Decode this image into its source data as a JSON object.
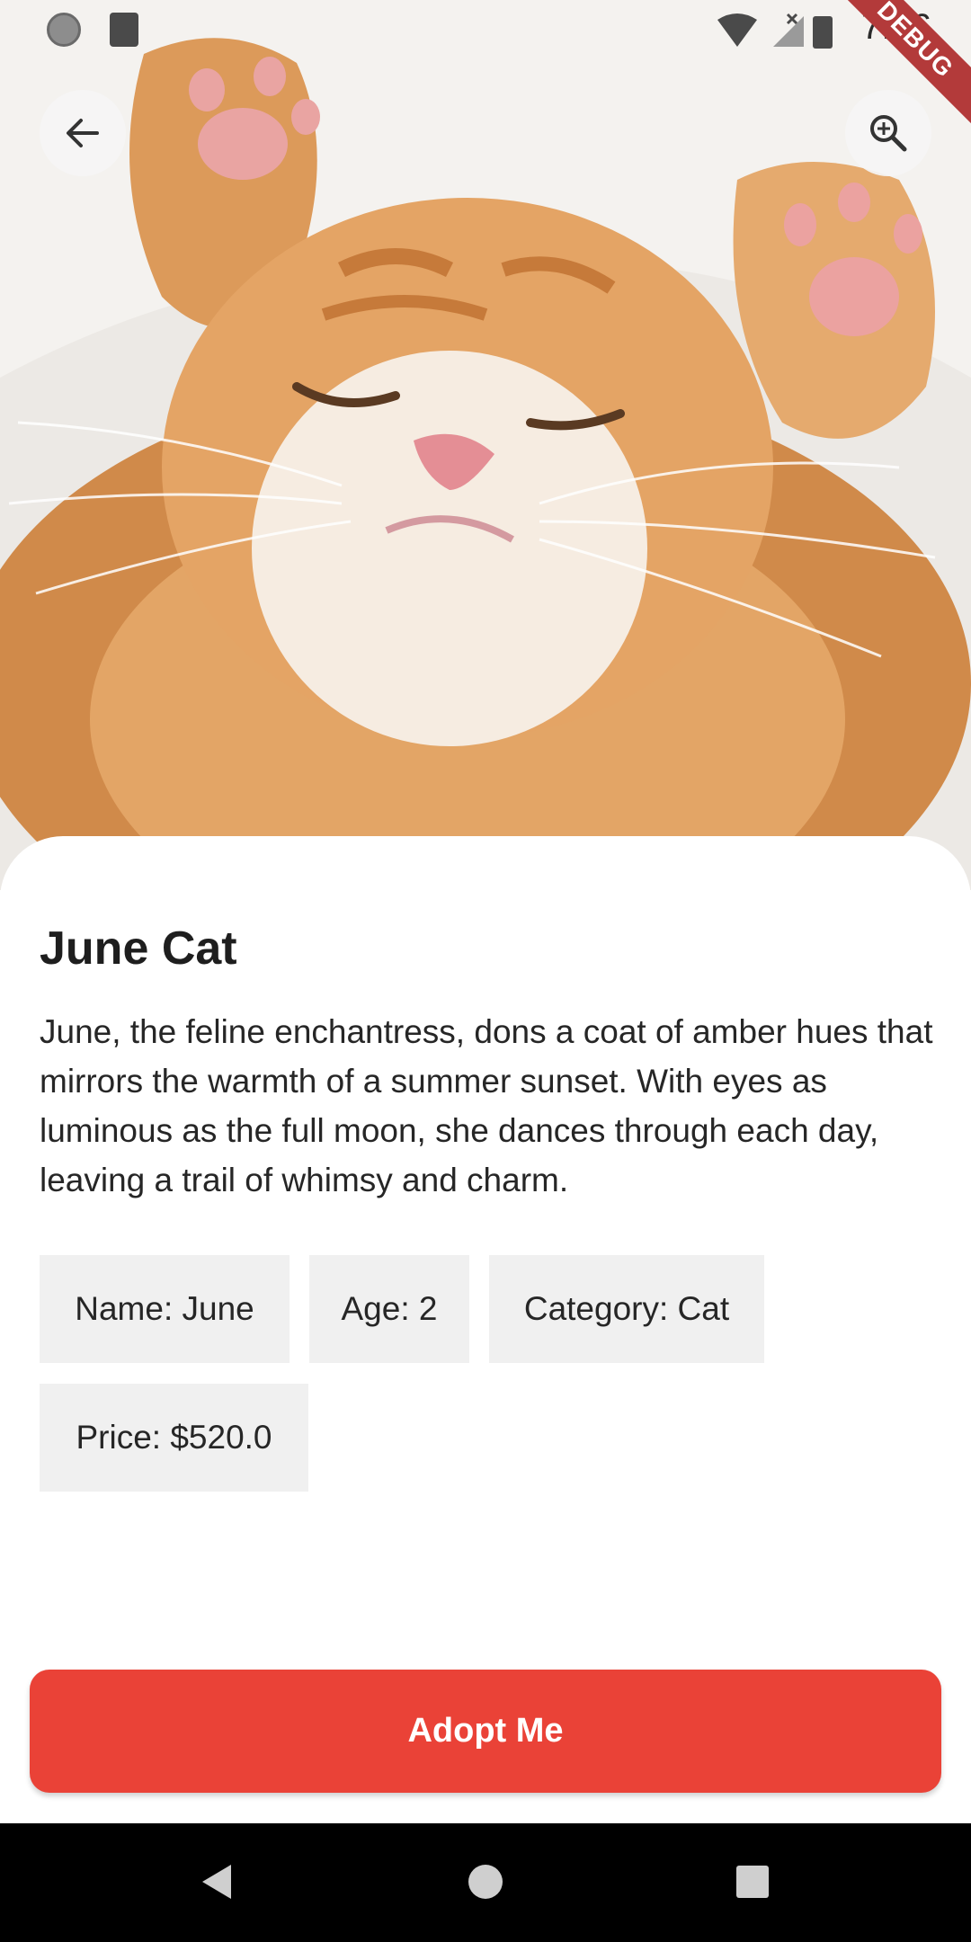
{
  "status_bar": {
    "time": "7:36",
    "debug_banner": "DEBUG"
  },
  "hero": {
    "image_icon": "kitten-photo",
    "back_icon": "arrow-left-icon",
    "zoom_icon": "zoom-in-icon"
  },
  "pet": {
    "title": "June Cat",
    "description": "June, the feline enchantress, dons a coat of amber hues that mirrors the warmth of a summer sunset. With eyes as luminous as the full moon, she dances through each day, leaving a trail of whimsy and charm.",
    "chips": {
      "name": "Name: June",
      "age": "Age: 2",
      "category": "Category: Cat",
      "price": "Price: $520.0"
    }
  },
  "actions": {
    "adopt_label": "Adopt Me"
  },
  "colors": {
    "accent": "#ea4237",
    "chip_background": "#f0f0f0",
    "debug_ribbon": "#b33a3a"
  }
}
